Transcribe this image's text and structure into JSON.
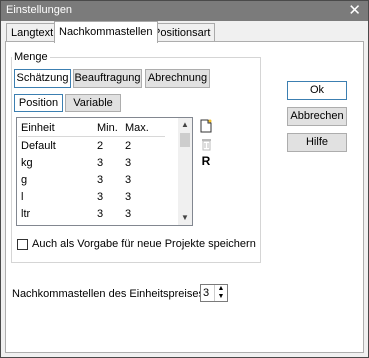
{
  "window": {
    "title": "Einstellungen"
  },
  "tabs": [
    {
      "label": "Langtext"
    },
    {
      "label": "Nachkommastellen"
    },
    {
      "label": "Positionsart"
    }
  ],
  "group": {
    "label": "Menge",
    "category_buttons": [
      {
        "label": "Schätzung"
      },
      {
        "label": "Beauftragung"
      },
      {
        "label": "Abrechnung"
      }
    ],
    "sub_tabs": [
      {
        "label": "Position"
      },
      {
        "label": "Variable"
      }
    ],
    "table": {
      "headers": [
        "Einheit",
        "Min.",
        "Max."
      ],
      "rows": [
        [
          "Default",
          "2",
          "2"
        ],
        [
          "kg",
          "3",
          "3"
        ],
        [
          "g",
          "3",
          "3"
        ],
        [
          "l",
          "3",
          "3"
        ],
        [
          "ltr",
          "3",
          "3"
        ]
      ]
    },
    "side_icons": {
      "new": "new-document-icon",
      "delete": "trash-icon",
      "reset_label": "R"
    },
    "checkbox_label": "Auch als Vorgabe für neue Projekte speichern"
  },
  "unit_price": {
    "label": "Nachkommastellen des Einheitspreises",
    "value": "3"
  },
  "buttons": {
    "ok": "Ok",
    "cancel": "Abbrechen",
    "help": "Hilfe"
  }
}
